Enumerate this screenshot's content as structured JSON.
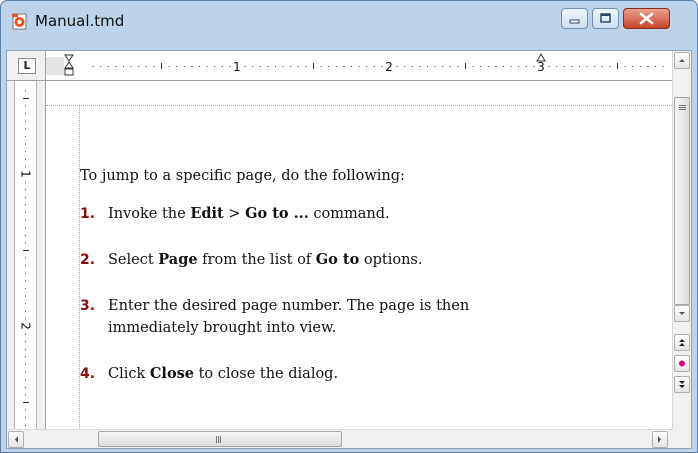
{
  "window": {
    "title": "Manual.tmd",
    "icon": "textmaker-document-icon"
  },
  "caption_buttons": [
    "minimize-icon",
    "maximize-icon",
    "close-icon"
  ],
  "ruler": {
    "corner_tab_stop": "L",
    "horizontal_numbers": [
      "1",
      "2",
      "3"
    ],
    "vertical_numbers": [
      "1",
      "2"
    ]
  },
  "document": {
    "intro": "To jump to a specific page, do the following:",
    "steps": [
      {
        "number": "1.",
        "parts": [
          "Invoke the ",
          "Edit",
          " > ",
          "Go to ...",
          " command."
        ]
      },
      {
        "number": "2.",
        "parts": [
          "Select ",
          "Page",
          " from the list of ",
          "Go to",
          " options."
        ]
      },
      {
        "number": "3.",
        "lines": [
          "Enter the desired page number. The page is then",
          "immediately brought into view."
        ]
      },
      {
        "number": "4.",
        "parts": [
          "Click ",
          "Close",
          " to close the dialog."
        ]
      }
    ]
  },
  "colors": {
    "title_bar": "#bcd3ea",
    "step_number": "#8b0d0d",
    "close_button": "#c7432a",
    "page_nav_dot": "#e0007a"
  },
  "scrollbars": {
    "vertical_buttons": [
      "scroll-up-icon",
      "scroll-down-icon",
      "previous-page-icon",
      "browse-object-icon",
      "next-page-icon"
    ],
    "horizontal_buttons": [
      "scroll-left-icon",
      "scroll-right-icon"
    ]
  }
}
